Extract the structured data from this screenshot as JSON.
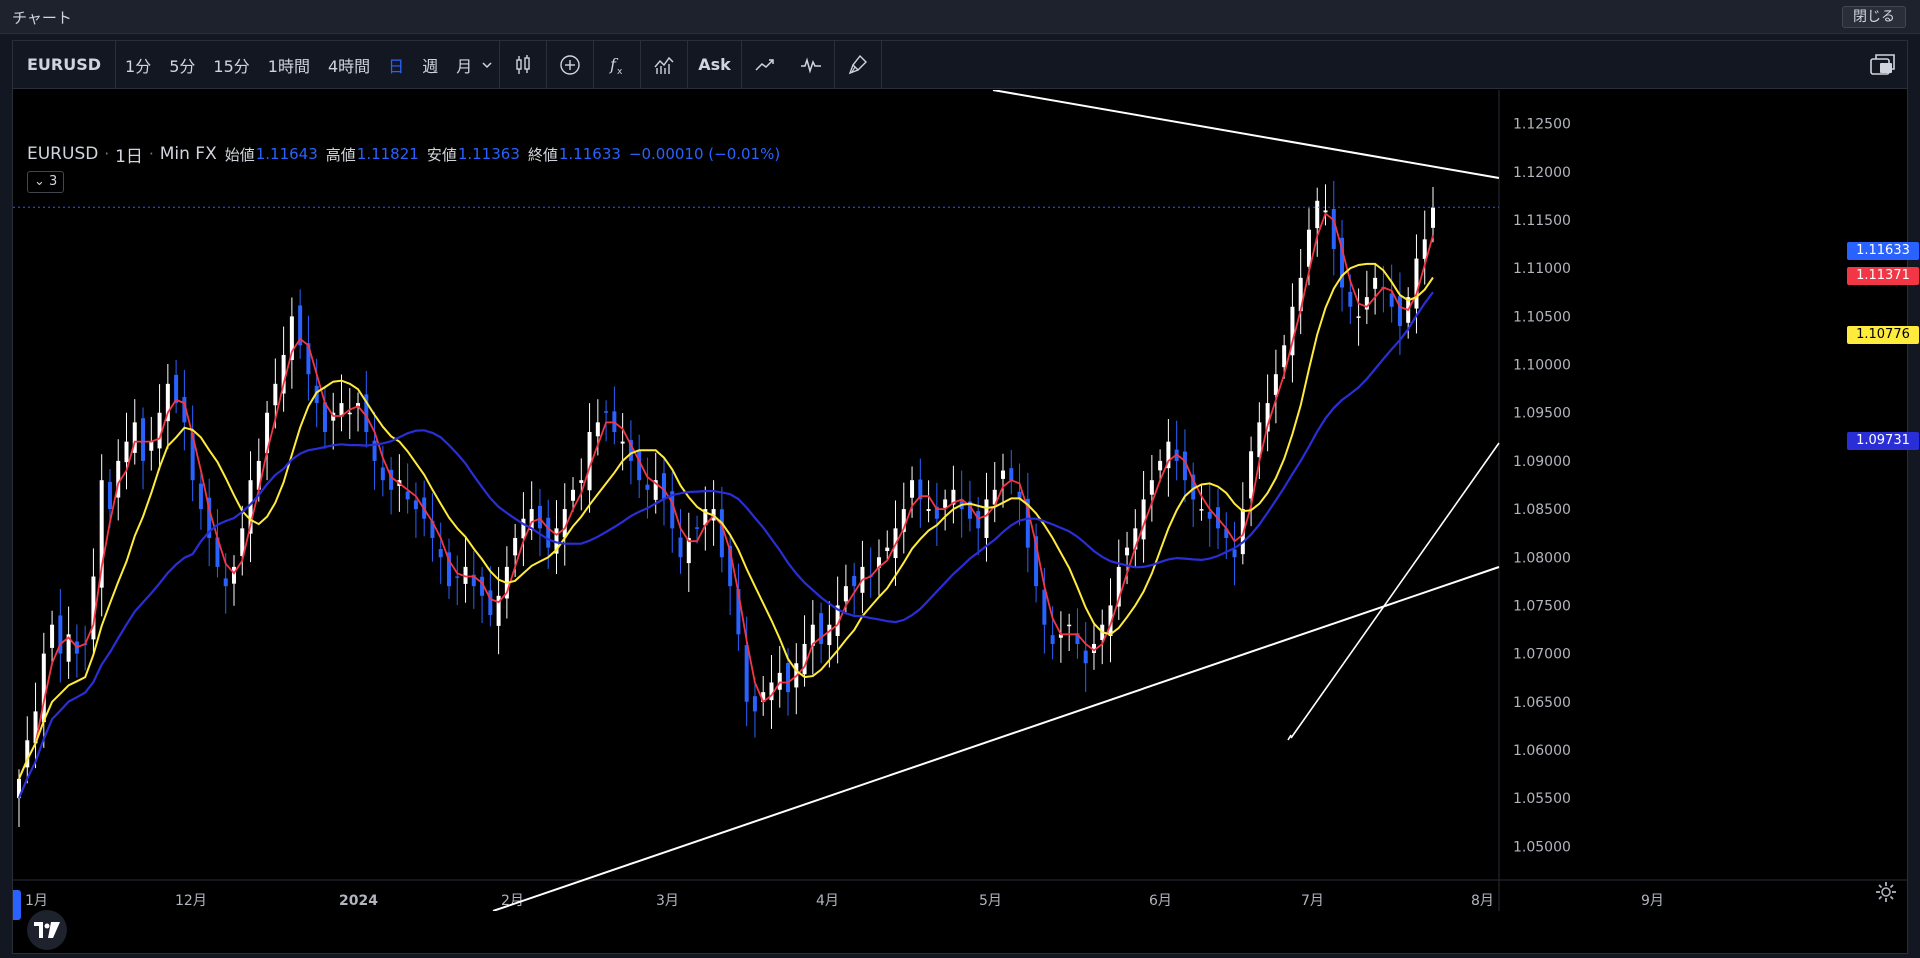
{
  "window": {
    "title": "チャート",
    "close_label": "閉じる"
  },
  "toolbar": {
    "symbol": "EURUSD",
    "intervals": [
      "1分",
      "5分",
      "15分",
      "1時間",
      "4時間",
      "日",
      "週",
      "月"
    ],
    "active_interval": "日",
    "ask_label": "Ask",
    "icons": [
      "candle-style-icon",
      "add-compare-icon",
      "indicators-icon",
      "templates-icon",
      "ask-icon",
      "trend-icon",
      "pulse-icon",
      "brush-icon"
    ]
  },
  "legend": {
    "symbol": "EURUSD",
    "interval": "1日",
    "source": "Min FX",
    "open_label": "始値",
    "open": "1.11643",
    "high_label": "高値",
    "high": "1.11821",
    "low_label": "安値",
    "low": "1.11363",
    "close_label": "終値",
    "close": "1.11633",
    "change": "−0.00010 (−0.01%)",
    "indicator_count": "3"
  },
  "colors": {
    "up": "#ffffff",
    "down": "#2962ff",
    "ma_fast": "#f23645",
    "ma_mid": "#ffeb3b",
    "ma_slow": "#2a2ed6",
    "trendline": "#ffffff",
    "current_price": "#2962ff"
  },
  "price_labels": {
    "last": "1.11633",
    "ma_fast": "1.11371",
    "ma_mid": "1.10776",
    "ma_slow": "1.09731"
  },
  "chart_data": {
    "type": "candlestick",
    "symbol": "EURUSD",
    "timeframe": "1日",
    "y_ticks": [
      "1.12500",
      "1.12000",
      "1.11500",
      "1.11000",
      "1.10500",
      "1.10000",
      "1.09500",
      "1.09000",
      "1.08500",
      "1.08000",
      "1.07500",
      "1.07000",
      "1.06500",
      "1.06000",
      "1.05500",
      "1.05000"
    ],
    "ylim": [
      1.0465,
      1.1285
    ],
    "x_ticks": [
      "1月",
      "12月",
      "2024",
      "2月",
      "3月",
      "4月",
      "5月",
      "6月",
      "7月",
      "8月",
      "9月"
    ],
    "x_tick_dates": [
      "2023-11-01",
      "2023-12-01",
      "2024-01-01",
      "2024-02-01",
      "2024-03-01",
      "2024-04-01",
      "2024-05-01",
      "2024-06-01",
      "2024-07-01",
      "2024-08-01",
      "2024-09-01"
    ],
    "last_price": 1.11633,
    "ohlc_close_path": [
      1.057,
      1.061,
      1.064,
      1.07,
      1.073,
      1.07,
      1.072,
      1.07,
      1.071,
      1.078,
      1.088,
      1.085,
      1.09,
      1.092,
      1.094,
      1.09,
      1.092,
      1.095,
      1.098,
      1.096,
      1.094,
      1.088,
      1.085,
      1.082,
      1.079,
      1.077,
      1.079,
      1.083,
      1.088,
      1.09,
      1.095,
      1.098,
      1.101,
      1.105,
      1.102,
      1.099,
      1.096,
      1.093,
      1.095,
      1.096,
      1.095,
      1.096,
      1.093,
      1.09,
      1.088,
      1.087,
      1.088,
      1.086,
      1.085,
      1.084,
      1.082,
      1.08,
      1.077,
      1.078,
      1.079,
      1.077,
      1.076,
      1.074,
      1.076,
      1.079,
      1.082,
      1.084,
      1.085,
      1.083,
      1.081,
      1.083,
      1.085,
      1.087,
      1.088,
      1.093,
      1.094,
      1.095,
      1.093,
      1.092,
      1.09,
      1.088,
      1.087,
      1.088,
      1.086,
      1.083,
      1.08,
      1.082,
      1.083,
      1.085,
      1.085,
      1.08,
      1.077,
      1.072,
      1.065,
      1.064,
      1.066,
      1.067,
      1.068,
      1.066,
      1.069,
      1.071,
      1.073,
      1.071,
      1.073,
      1.075,
      1.077,
      1.077,
      1.079,
      1.078,
      1.08,
      1.081,
      1.083,
      1.085,
      1.088,
      1.086,
      1.085,
      1.084,
      1.086,
      1.087,
      1.085,
      1.084,
      1.083,
      1.086,
      1.087,
      1.089,
      1.088,
      1.086,
      1.081,
      1.077,
      1.073,
      1.071,
      1.072,
      1.073,
      1.071,
      1.069,
      1.071,
      1.073,
      1.075,
      1.079,
      1.081,
      1.083,
      1.086,
      1.088,
      1.09,
      1.092,
      1.09,
      1.088,
      1.086,
      1.085,
      1.084,
      1.083,
      1.082,
      1.08,
      1.085,
      1.091,
      1.094,
      1.096,
      1.099,
      1.102,
      1.106,
      1.109,
      1.114,
      1.117,
      1.116,
      1.112,
      1.108,
      1.106,
      1.105,
      1.107,
      1.109,
      1.108,
      1.106,
      1.104,
      1.107,
      1.111,
      1.113,
      1.1163
    ]
  }
}
